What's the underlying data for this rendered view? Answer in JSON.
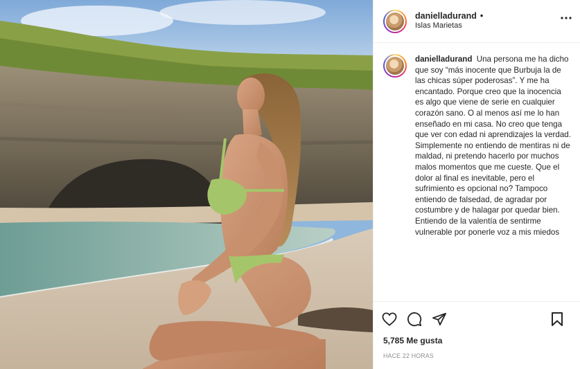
{
  "post": {
    "username": "danielladurand",
    "dot": "•",
    "location": "Islas Marietas",
    "caption": "Una persona me ha dicho que soy “más inocente que Burbuja la de las chicas súper poderosas”. Y me ha encantado. Porque creo que la inocencia es algo que viene de serie en cualquier corazón sano. O al menos así me lo han enseñado en mi casa. No creo que tenga que ver con edad ni aprendizajes la verdad. Simplemente no entiendo de mentiras ni de maldad, ni pretendo hacerlo por muchos malos momentos que me cueste. Que el dolor al final es inevitable, pero el sufrimiento es opcional no? Tampoco entiendo de falsedad, de agradar por costumbre y de halagar por quedar bien. Entiendo de la valentía de sentirme vulnerable por ponerle voz a mis miedos",
    "likes": "5,785 Me gusta",
    "timestamp": "HACE 22 HORAS"
  },
  "icons": {
    "more": "more-horizontal-icon",
    "like": "heart-icon",
    "comment": "comment-icon",
    "share": "paper-plane-icon",
    "save": "bookmark-icon"
  },
  "colors": {
    "text": "#262626",
    "muted": "#8e8e8e",
    "border": "#efefef",
    "bikini": "#a5c56a"
  }
}
